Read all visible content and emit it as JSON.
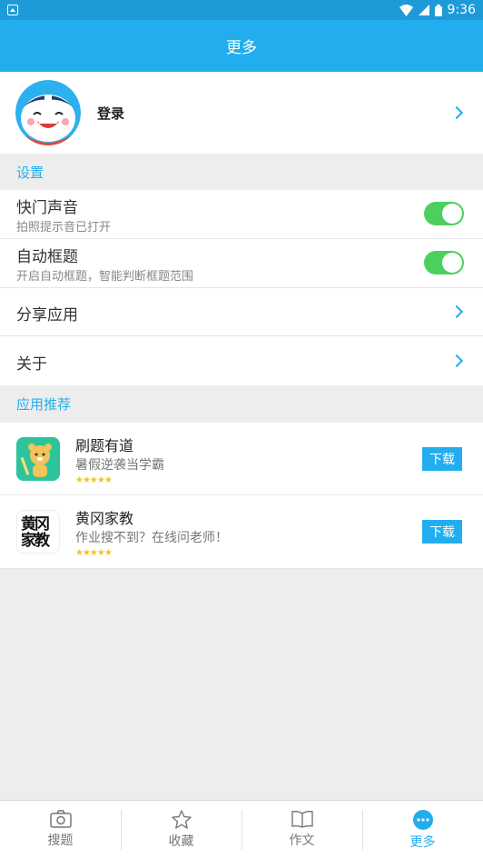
{
  "status_bar": {
    "time": "9:36"
  },
  "header": {
    "title": "更多"
  },
  "login": {
    "label": "登录"
  },
  "settings": {
    "section_label": "设置",
    "items": [
      {
        "title": "快门声音",
        "subtitle": "拍照提示音已打开",
        "toggle_on": true
      },
      {
        "title": "自动框题",
        "subtitle": "开启自动框题，智能判断框题范围",
        "toggle_on": true
      },
      {
        "title": "分享应用"
      },
      {
        "title": "关于"
      }
    ]
  },
  "recommend": {
    "section_label": "应用推荐",
    "apps": [
      {
        "name": "刷题有道",
        "desc": "暑假逆袭当学霸",
        "stars": "★★★★★",
        "button": "下载"
      },
      {
        "name": "黄冈家教",
        "desc": "作业搜不到？在线问老师！",
        "stars": "★★★★★",
        "button": "下载",
        "icon_text": "黄冈家教"
      }
    ]
  },
  "tabbar": {
    "items": [
      {
        "label": "搜题",
        "icon": "camera-icon"
      },
      {
        "label": "收藏",
        "icon": "star-icon"
      },
      {
        "label": "作文",
        "icon": "book-icon"
      },
      {
        "label": "更多",
        "icon": "more-icon",
        "active": true
      }
    ]
  },
  "colors": {
    "primary": "#22aeee",
    "status_bar": "#1e9ad8",
    "toggle": "#4cd05d",
    "star": "#f4c419"
  }
}
